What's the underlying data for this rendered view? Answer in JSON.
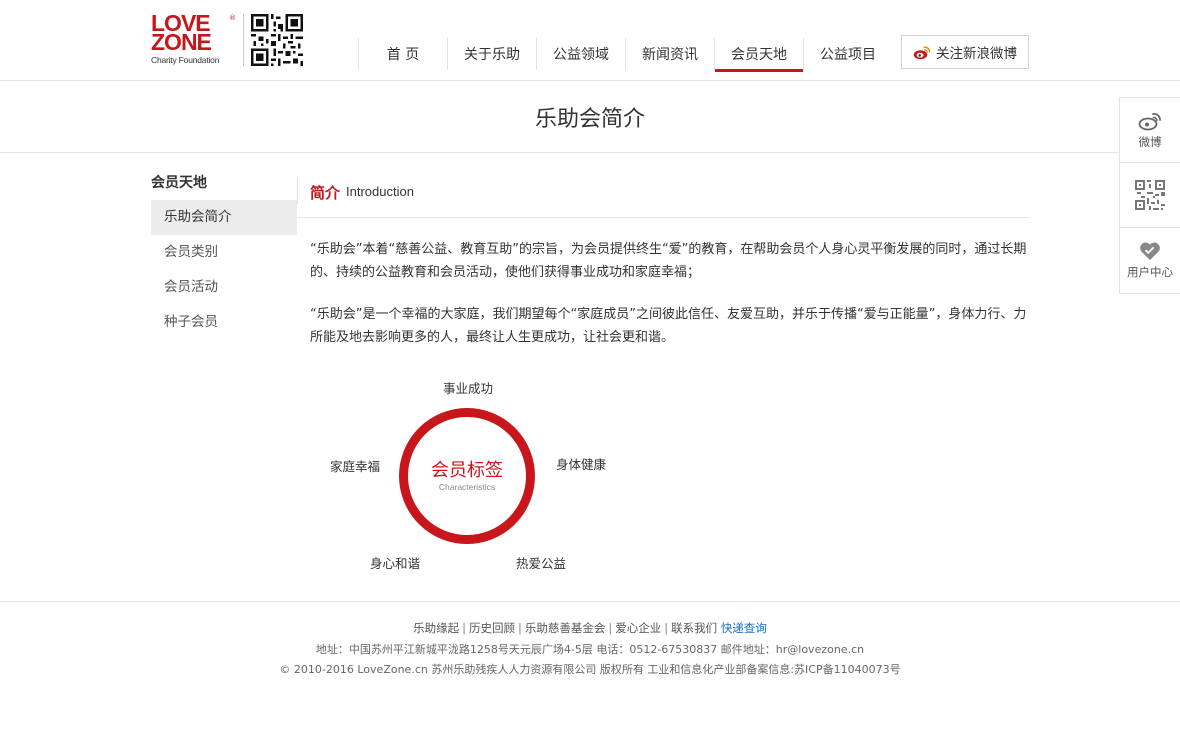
{
  "logo": {
    "line1": "LOVE",
    "line2": "ZONE",
    "reg": "®",
    "tagline": "Charity Foundation"
  },
  "nav": {
    "items": [
      {
        "label": "首 页"
      },
      {
        "label": "关于乐助"
      },
      {
        "label": "公益领域"
      },
      {
        "label": "新闻资讯"
      },
      {
        "label": "会员天地",
        "active": true
      },
      {
        "label": "公益项目"
      }
    ],
    "weibo_button": "关注新浪微博"
  },
  "banner": {
    "title": "乐助会简介"
  },
  "float_bar": {
    "items": [
      {
        "label": "微博",
        "icon": "weibo-icon"
      },
      {
        "label": "",
        "icon": "qr-code-icon"
      },
      {
        "label": "用户中心",
        "icon": "heart-icon"
      }
    ]
  },
  "left_menu": {
    "title": "会员天地",
    "items": [
      {
        "label": "乐助会简介",
        "active": true
      },
      {
        "label": "会员类别"
      },
      {
        "label": "会员活动"
      },
      {
        "label": "种子会员"
      }
    ]
  },
  "content": {
    "heading_zh": "简介",
    "heading_en": "Introduction",
    "paragraph1": "“乐助会”本着“慈善公益、教育互助”的宗旨，为会员提供终生“爱”的教育，在帮助会员个人身心灵平衡发展的同时，通过长期的、持续的公益教育和会员活动，使他们获得事业成功和家庭幸福；",
    "paragraph2": "“乐助会”是一个幸福的大家庭，我们期望每个“家庭成员”之间彼此信任、友爱互助，并乐于传播“爱与正能量”，身体力行、力所能及地去影响更多的人，最终让人生更成功，让社会更和谐。"
  },
  "diagram": {
    "center_zh": "会员标签",
    "center_en": "Characteristics",
    "tags": [
      "事业成功",
      "身体健康",
      "热爱公益",
      "身心和谐",
      "家庭幸福"
    ]
  },
  "footer": {
    "links": [
      "乐助缘起",
      "历史回顾",
      "乐助慈善基金会",
      "爱心企业",
      "联系我们",
      "快递查询"
    ],
    "address_line": "地址：中国苏州平江新城平泷路1258号天元辰广场4-5层 电话：0512-67530837 邮件地址：hr@lovezone.cn",
    "copyright_line": "© 2010-2016 LoveZone.cn 苏州乐助残疾人人力资源有限公司 版权所有    工业和信息化产业部备案信息:苏ICP备11040073号"
  },
  "colors": {
    "brand_red": "#c8161d",
    "link_blue": "#1a6fc4"
  }
}
